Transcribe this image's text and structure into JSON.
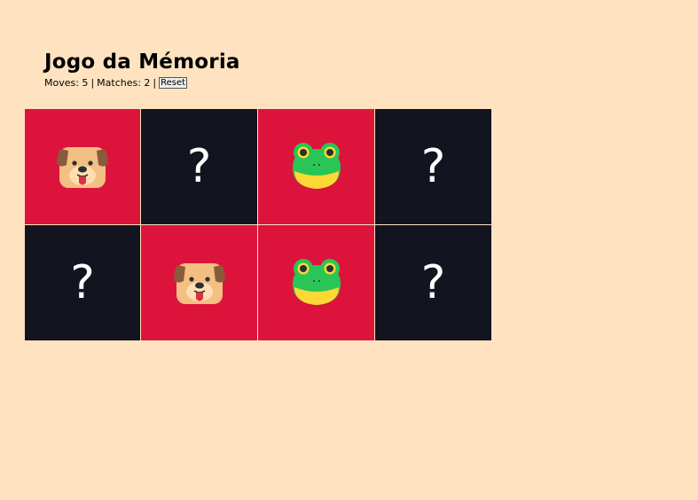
{
  "header": {
    "title": "Jogo da Mémoria",
    "moves_label": "Moves: 5",
    "separator": "|",
    "matches_label": "Matches: 2",
    "reset_label": "Reset"
  },
  "board": {
    "hidden_symbol": "?",
    "cards": [
      {
        "state": "revealed",
        "icon": "dog-face-icon"
      },
      {
        "state": "hidden",
        "symbol": "?"
      },
      {
        "state": "revealed",
        "icon": "frog-face-icon"
      },
      {
        "state": "hidden",
        "symbol": "?"
      },
      {
        "state": "hidden",
        "symbol": "?"
      },
      {
        "state": "revealed",
        "icon": "dog-face-icon"
      },
      {
        "state": "revealed",
        "icon": "frog-face-icon"
      },
      {
        "state": "hidden",
        "symbol": "?"
      }
    ]
  },
  "colors": {
    "background": "#ffe3c1",
    "card_hidden": "#12141f",
    "card_revealed": "#dc143c"
  }
}
